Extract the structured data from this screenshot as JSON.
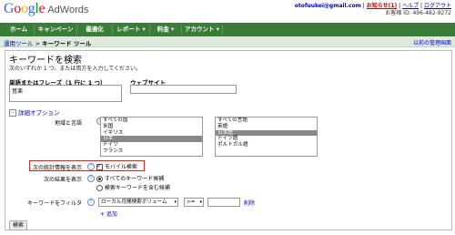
{
  "header": {
    "logo_text": "Google",
    "product": "AdWords",
    "email": "otofuukei@gmail.com",
    "alerts_link": "お知らせ(1)",
    "help_link": "ヘルプ",
    "logout_link": "ログアウト",
    "customer_id": "お客様 ID: 496-482-9272"
  },
  "nav": {
    "tabs": [
      {
        "label": "ホーム"
      },
      {
        "label": "キャンペーン"
      },
      {
        "label": "最適化"
      },
      {
        "label": "レポート ▾"
      },
      {
        "label": "料金 ▾"
      },
      {
        "label": "アカウント ▾"
      }
    ]
  },
  "breadcrumb": {
    "parent": "運用ツール",
    "separator": " > ",
    "current": "キーワード ツール"
  },
  "prev_version_link": "以前の管理画面",
  "search": {
    "title": "キーワードを検索",
    "instructions": "次のいずれか 1 つ、または両方を入力してください。",
    "words_label": "単語またはフレーズ（1 行に 1 つ）",
    "words_value": "音楽",
    "website_label": "ウェブサイト",
    "website_value": ""
  },
  "advanced": {
    "toggle": "–",
    "label": "詳細オプション",
    "location_language_label": "地域と言語",
    "locations": [
      {
        "label": "すべての国",
        "selected": false
      },
      {
        "label": "米国",
        "selected": false
      },
      {
        "label": "イギリス",
        "selected": false
      },
      {
        "label": "日本",
        "selected": true
      },
      {
        "label": "ドイツ",
        "selected": false
      },
      {
        "label": "フランス",
        "selected": false
      }
    ],
    "languages": [
      {
        "label": "すべての言語",
        "selected": false
      },
      {
        "label": "英語",
        "selected": false
      },
      {
        "label": "日本語",
        "selected": true
      },
      {
        "label": "ドイツ語",
        "selected": false
      },
      {
        "label": "ポルトガル語",
        "selected": false
      }
    ],
    "stats_label": "次の統計情報を表示",
    "mobile_search_label": "モバイル検索",
    "mobile_search_checked": true,
    "results_label": "次の結果を表示",
    "result_options": [
      {
        "label": "すべてのキーワード候補",
        "checked": true
      },
      {
        "label": "検索キーワードを含む候補",
        "checked": false
      }
    ],
    "filter_label": "キーワードをフィルタ",
    "filter_field": "ローカル月間検索ボリューム",
    "filter_operator": ">=",
    "filter_value": "",
    "filter_delete": "削除",
    "add_link": "+ 追加"
  },
  "search_button": "検索",
  "help_icon_glyph": "?",
  "colors": {
    "nav_green": "#3a7d38",
    "link_blue": "#0000cc",
    "alert_red": "#cc0000",
    "highlight_border": "#dd2222"
  }
}
